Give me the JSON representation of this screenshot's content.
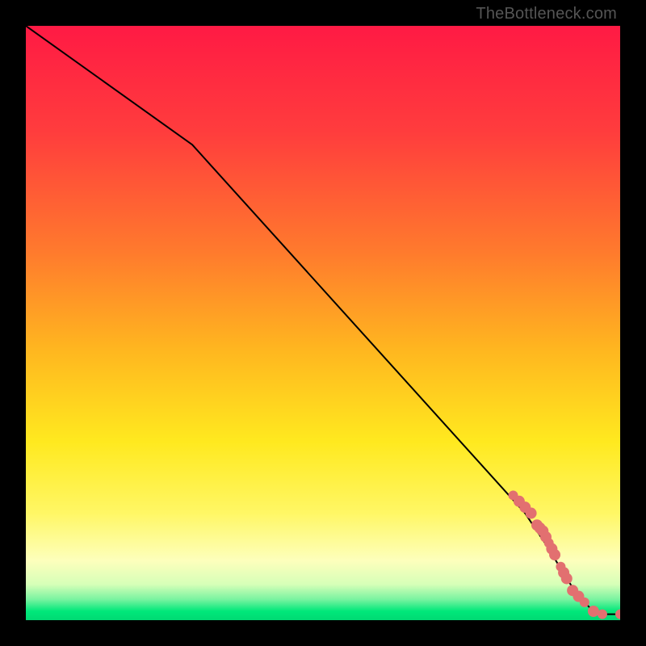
{
  "watermark": "TheBottleneck.com",
  "colors": {
    "frame": "#000000",
    "line": "#000000",
    "marker": "#e27070",
    "gradient_stops": [
      {
        "offset": 0.0,
        "color": "#ff1a44"
      },
      {
        "offset": 0.18,
        "color": "#ff3d3d"
      },
      {
        "offset": 0.38,
        "color": "#ff7a2d"
      },
      {
        "offset": 0.55,
        "color": "#ffb81f"
      },
      {
        "offset": 0.7,
        "color": "#ffe91f"
      },
      {
        "offset": 0.82,
        "color": "#fff765"
      },
      {
        "offset": 0.9,
        "color": "#fdffbc"
      },
      {
        "offset": 0.94,
        "color": "#d6ffb8"
      },
      {
        "offset": 0.965,
        "color": "#79f3a0"
      },
      {
        "offset": 0.985,
        "color": "#00e87a"
      },
      {
        "offset": 1.0,
        "color": "#00d973"
      }
    ]
  },
  "chart_data": {
    "type": "line",
    "title": "",
    "xlabel": "",
    "ylabel": "",
    "xlim": [
      0,
      100
    ],
    "ylim": [
      0,
      100
    ],
    "series": [
      {
        "name": "bottleneck-curve",
        "x": [
          0,
          28,
          84,
          88,
          91,
          93,
          95,
          97,
          100
        ],
        "y": [
          100,
          80,
          18,
          12,
          7,
          4,
          2,
          1,
          1
        ]
      }
    ],
    "markers": [
      {
        "name": "cluster-points",
        "color": "#e27070",
        "x": [
          82,
          83,
          84,
          85,
          86,
          86.5,
          87,
          87.5,
          88,
          88.5,
          89,
          90,
          90.5,
          91,
          92,
          93,
          94,
          95.5,
          97,
          100
        ],
        "y": [
          21,
          20,
          19,
          18,
          16,
          15.5,
          15,
          14,
          13,
          12,
          11,
          9,
          8,
          7,
          5,
          4,
          3,
          1.5,
          1,
          1
        ],
        "r": [
          6,
          7,
          7,
          7,
          7,
          7,
          7,
          7,
          6,
          7,
          7,
          6,
          7,
          7,
          7,
          7,
          6,
          7,
          6,
          6
        ]
      }
    ]
  }
}
